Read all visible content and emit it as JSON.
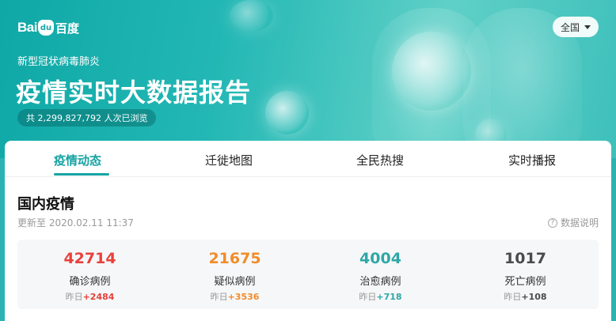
{
  "header": {
    "logo_bai": "Bai",
    "logo_du": "du",
    "logo_cn": "百度",
    "region_label": "全国",
    "subtitle": "新型冠状病毒肺炎",
    "title": "疫情实时大数据报告",
    "views_text": "共 2,299,827,792 人次已浏览"
  },
  "tabs": [
    {
      "label": "疫情动态",
      "active": true
    },
    {
      "label": "迁徙地图",
      "active": false
    },
    {
      "label": "全民热搜",
      "active": false
    },
    {
      "label": "实时播报",
      "active": false
    }
  ],
  "domestic": {
    "title": "国内疫情",
    "updated": "更新至 2020.02.11 11:37",
    "help_label": "数据说明",
    "yesterday_prefix": "昨日",
    "stats": [
      {
        "value": "42714",
        "label": "确诊病例",
        "delta": "+2484",
        "color": "#e8413c"
      },
      {
        "value": "21675",
        "label": "疑似病例",
        "delta": "+3536",
        "color": "#f08c2b"
      },
      {
        "value": "4004",
        "label": "治愈病例",
        "delta": "+718",
        "color": "#2fa7a7"
      },
      {
        "value": "1017",
        "label": "死亡病例",
        "delta": "+108",
        "color": "#4b4b4b"
      }
    ]
  },
  "icons": {
    "help": "question-circle-icon",
    "region_dropdown": "caret-down-icon"
  }
}
